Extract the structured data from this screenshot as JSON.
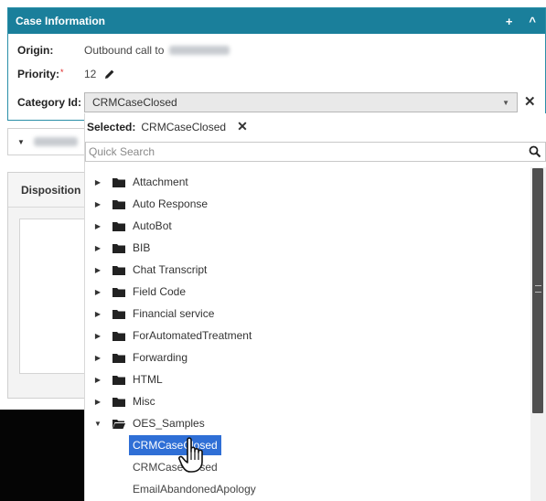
{
  "panel": {
    "title": "Case Information",
    "add_icon": "+",
    "collapse_icon": "^"
  },
  "fields": {
    "origin_label": "Origin:",
    "origin_value": "Outbound call to",
    "priority_label": "Priority:",
    "priority_required": "*",
    "priority_value": "12",
    "category_label": "Category Id:",
    "category_value": "CRMCaseClosed"
  },
  "dropdown": {
    "selected_label": "Selected:",
    "selected_value": "CRMCaseClosed",
    "search_placeholder": "Quick Search",
    "folders": [
      {
        "label": "Attachment",
        "expanded": false
      },
      {
        "label": "Auto Response",
        "expanded": false
      },
      {
        "label": "AutoBot",
        "expanded": false
      },
      {
        "label": "BIB",
        "expanded": false
      },
      {
        "label": "Chat Transcript",
        "expanded": false
      },
      {
        "label": "Field Code",
        "expanded": false
      },
      {
        "label": "Financial service",
        "expanded": false
      },
      {
        "label": "ForAutomatedTreatment",
        "expanded": false
      },
      {
        "label": "Forwarding",
        "expanded": false
      },
      {
        "label": "HTML",
        "expanded": false
      },
      {
        "label": "Misc",
        "expanded": false
      },
      {
        "label": "OES_Samples",
        "expanded": true
      }
    ],
    "children": [
      {
        "label": "CRMCaseClosed",
        "active": true
      },
      {
        "label": "CRMCaseClosed",
        "active": false
      },
      {
        "label": "EmailAbandonedApology",
        "active": false
      }
    ]
  },
  "left_panel": {
    "disposition_tab": "Disposition"
  },
  "colors": {
    "header": "#1a7f9b",
    "selection": "#2f6fd6"
  }
}
